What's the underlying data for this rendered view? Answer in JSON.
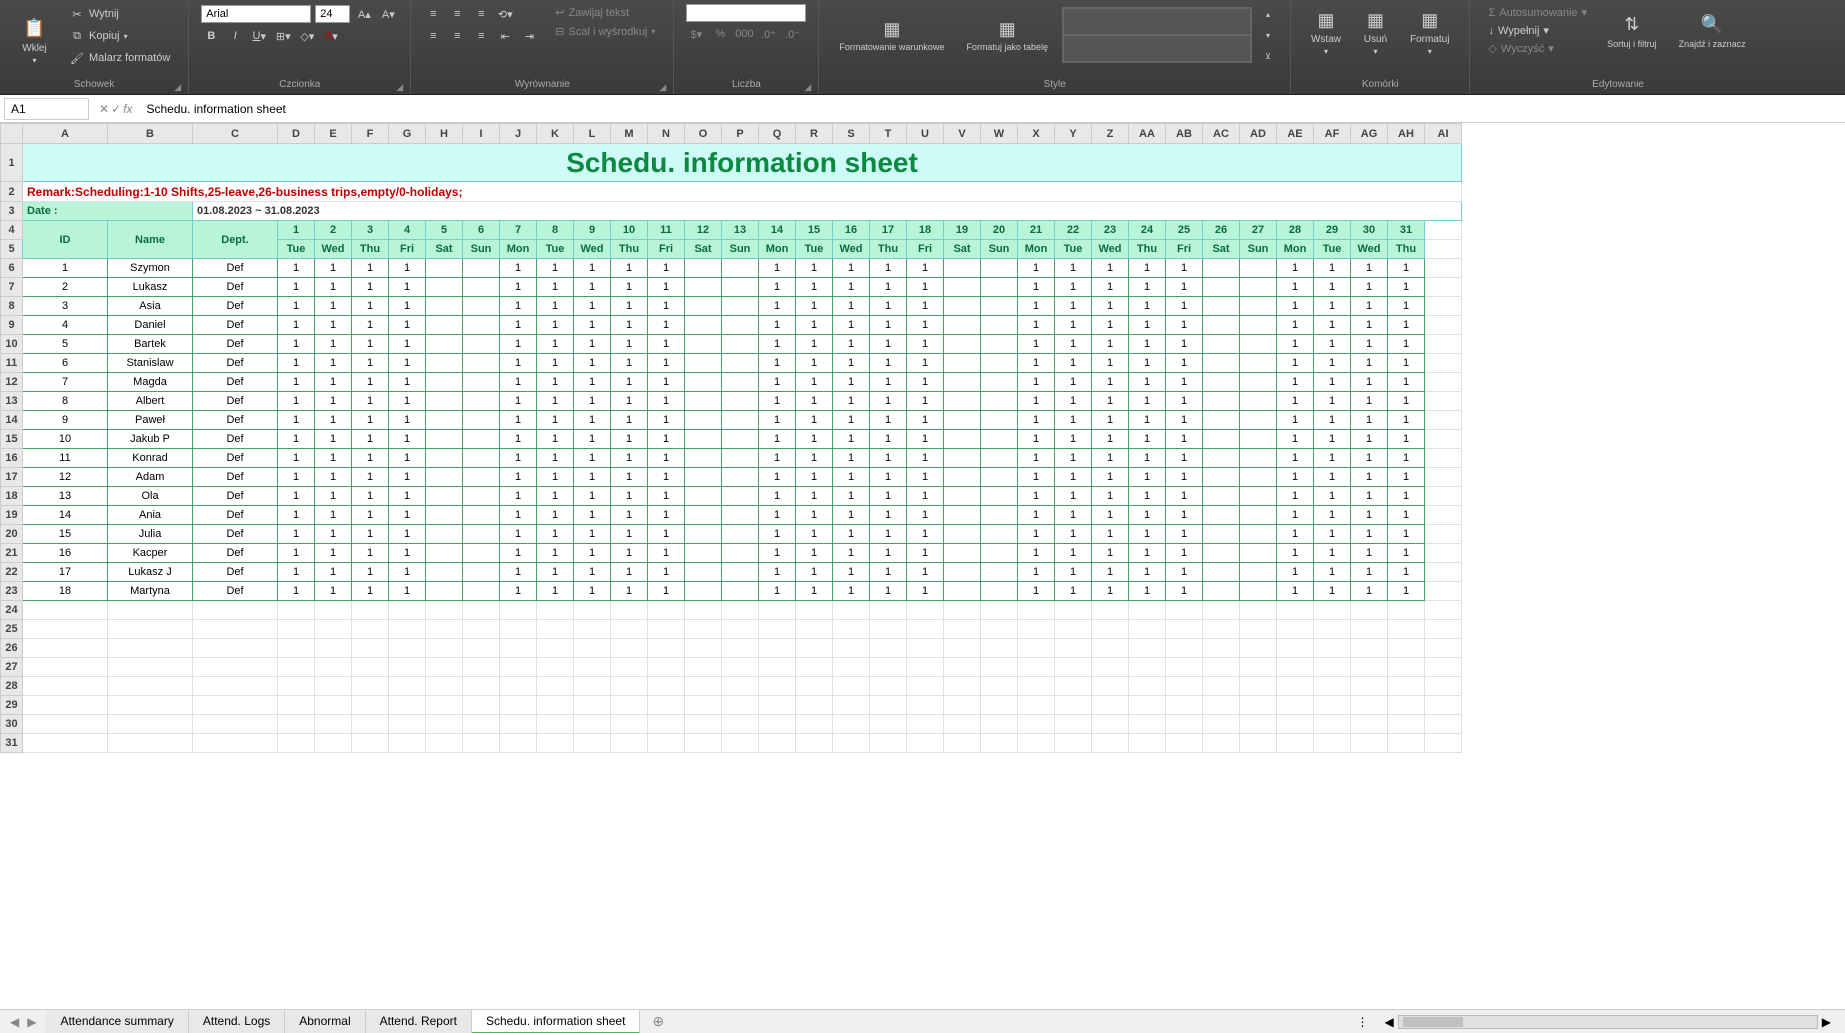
{
  "ribbon": {
    "groups": {
      "clipboard": {
        "label": "Schowek",
        "paste": "Wklej",
        "cut": "Wytnij",
        "copy": "Kopiuj",
        "format_painter": "Malarz formatów"
      },
      "font": {
        "label": "Czcionka",
        "font_name": "Arial",
        "font_size": "24"
      },
      "alignment": {
        "label": "Wyrównanie",
        "wrap": "Zawijaj tekst",
        "merge": "Scal i wyśrodkuj"
      },
      "number": {
        "label": "Liczba",
        "format": ""
      },
      "styles": {
        "label": "Style",
        "cond_format": "Formatowanie warunkowe",
        "table_format": "Formatuj jako tabelę"
      },
      "cells": {
        "label": "Komórki",
        "insert": "Wstaw",
        "delete": "Usuń",
        "format": "Formatuj"
      },
      "editing": {
        "label": "Edytowanie",
        "autosum": "Autosumowanie",
        "fill": "Wypełnij",
        "clear": "Wyczyść",
        "sort": "Sortuj i filtruj",
        "find": "Znajdź i zaznacz"
      }
    }
  },
  "formula_bar": {
    "cell_ref": "A1",
    "content": "Schedu. information sheet"
  },
  "columns": [
    "A",
    "B",
    "C",
    "D",
    "E",
    "F",
    "G",
    "H",
    "I",
    "J",
    "K",
    "L",
    "M",
    "N",
    "O",
    "P",
    "Q",
    "R",
    "S",
    "T",
    "U",
    "V",
    "W",
    "X",
    "Y",
    "Z",
    "AA",
    "AB",
    "AC",
    "AD",
    "AE",
    "AF",
    "AG",
    "AH",
    "AI"
  ],
  "sheet": {
    "title": "Schedu. information sheet",
    "remark": "Remark:Scheduling:1-10 Shifts,25-leave,26-business trips,empty/0-holidays;",
    "date_label": "Date :",
    "date_value": "01.08.2023 ~ 31.08.2023",
    "headers": {
      "id": "ID",
      "name": "Name",
      "dept": "Dept."
    },
    "day_nums": [
      "1",
      "2",
      "3",
      "4",
      "5",
      "6",
      "7",
      "8",
      "9",
      "10",
      "11",
      "12",
      "13",
      "14",
      "15",
      "16",
      "17",
      "18",
      "19",
      "20",
      "21",
      "22",
      "23",
      "24",
      "25",
      "26",
      "27",
      "28",
      "29",
      "30",
      "31"
    ],
    "day_names": [
      "Tue",
      "Wed",
      "Thu",
      "Fri",
      "Sat",
      "Sun",
      "Mon",
      "Tue",
      "Wed",
      "Thu",
      "Fri",
      "Sat",
      "Sun",
      "Mon",
      "Tue",
      "Wed",
      "Thu",
      "Fri",
      "Sat",
      "Sun",
      "Mon",
      "Tue",
      "Wed",
      "Thu",
      "Fri",
      "Sat",
      "Sun",
      "Mon",
      "Tue",
      "Wed",
      "Thu"
    ],
    "rows": [
      {
        "id": "1",
        "name": "Szymon",
        "dept": "Def"
      },
      {
        "id": "2",
        "name": "Lukasz",
        "dept": "Def"
      },
      {
        "id": "3",
        "name": "Asia",
        "dept": "Def"
      },
      {
        "id": "4",
        "name": "Daniel",
        "dept": "Def"
      },
      {
        "id": "5",
        "name": "Bartek",
        "dept": "Def"
      },
      {
        "id": "6",
        "name": "Stanislaw",
        "dept": "Def"
      },
      {
        "id": "7",
        "name": "Magda",
        "dept": "Def"
      },
      {
        "id": "8",
        "name": "Albert",
        "dept": "Def"
      },
      {
        "id": "9",
        "name": "Paweł",
        "dept": "Def"
      },
      {
        "id": "10",
        "name": "Jakub P",
        "dept": "Def"
      },
      {
        "id": "11",
        "name": "Konrad",
        "dept": "Def"
      },
      {
        "id": "12",
        "name": "Adam",
        "dept": "Def"
      },
      {
        "id": "13",
        "name": "Ola",
        "dept": "Def"
      },
      {
        "id": "14",
        "name": "Ania",
        "dept": "Def"
      },
      {
        "id": "15",
        "name": "Julia",
        "dept": "Def"
      },
      {
        "id": "16",
        "name": "Kacper",
        "dept": "Def"
      },
      {
        "id": "17",
        "name": "Lukasz J",
        "dept": "Def"
      },
      {
        "id": "18",
        "name": "Martyna",
        "dept": "Def"
      }
    ],
    "shift_value": "1",
    "weekend_indices": [
      4,
      5,
      11,
      12,
      18,
      19,
      25,
      26
    ]
  },
  "tabs": {
    "items": [
      "Attendance summary",
      "Attend. Logs",
      "Abnormal",
      "Attend. Report",
      "Schedu. information sheet"
    ],
    "active": 4
  }
}
